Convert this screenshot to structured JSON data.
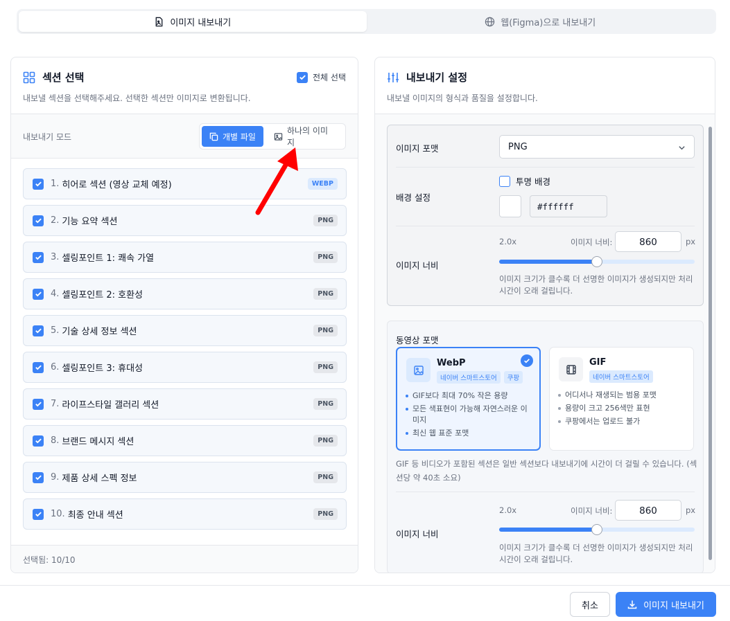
{
  "tabs": [
    {
      "label": "이미지 내보내기",
      "icon": "image-file-icon",
      "active": true
    },
    {
      "label": "웹(Figma)으로 내보내기",
      "icon": "globe-icon",
      "active": false
    }
  ],
  "left": {
    "title": "섹션 선택",
    "description": "내보낼 섹션을 선택해주세요. 선택한 섹션만 이미지로 변환됩니다.",
    "select_all_label": "전체 선택",
    "mode_label": "내보내기 모드",
    "mode_options": [
      "개별 파일",
      "하나의 이미지"
    ],
    "sections": [
      {
        "num": "1.",
        "name": "히어로 섹션 (영상 교체 예정)",
        "format": "WEBP"
      },
      {
        "num": "2.",
        "name": "기능 요약 섹션",
        "format": "PNG"
      },
      {
        "num": "3.",
        "name": "셀링포인트 1: 쾌속 가열",
        "format": "PNG"
      },
      {
        "num": "4.",
        "name": "셀링포인트 2: 호환성",
        "format": "PNG"
      },
      {
        "num": "5.",
        "name": "기술 상세 정보 섹션",
        "format": "PNG"
      },
      {
        "num": "6.",
        "name": "셀링포인트 3: 휴대성",
        "format": "PNG"
      },
      {
        "num": "7.",
        "name": "라이프스타일 갤러리 섹션",
        "format": "PNG"
      },
      {
        "num": "8.",
        "name": "브랜드 메시지 섹션",
        "format": "PNG"
      },
      {
        "num": "9.",
        "name": "제품 상세 스펙 정보",
        "format": "PNG"
      },
      {
        "num": "10.",
        "name": "최종 안내 섹션",
        "format": "PNG"
      }
    ],
    "footer": "선택됨: 10/10"
  },
  "right": {
    "title": "내보내기 설정",
    "description": "내보낼 이미지의 형식과 품질을 설정합니다.",
    "image_format_label": "이미지 포맷",
    "image_format_value": "PNG",
    "background_label": "배경 설정",
    "transparent_label": "투명 배경",
    "transparent_checked": false,
    "bg_color": "#ffffff",
    "image_width_label": "이미지 너비",
    "scale": "2.0x",
    "width_field_label": "이미지 너비:",
    "width_value": "860",
    "unit": "px",
    "slider_fraction": 0.5,
    "help_text": "이미지 크기가 클수록 더 선명한 이미지가 생성되지만 처리 시간이 오래 걸립니다.",
    "video_format_label": "동영상 포맷",
    "video_options": [
      {
        "name": "WebP",
        "icon": "image-icon",
        "selected": true,
        "tags": [
          "네이버 스마트스토어",
          "쿠팡"
        ],
        "bullets": [
          "GIF보다 최대 70% 작은 용량",
          "모든 색표현이 가능해 자연스러운 이미지",
          "최신 웹 표준 포맷"
        ]
      },
      {
        "name": "GIF",
        "icon": "film-icon",
        "selected": false,
        "tags": [
          "네이버 스마트스토어"
        ],
        "bullets": [
          "어디서나 재생되는 범용 포맷",
          "용량이 크고 256색만 표현",
          "쿠팡에서는 업로드 불가"
        ]
      }
    ],
    "video_note": "GIF 등 비디오가 포함된 섹션은 일반 섹션보다 내보내기에 시간이 더 걸릴 수 있습니다. (섹션당 약 40초 소요)",
    "video_width_label": "이미지 너비",
    "video_scale": "2.0x",
    "video_width_value": "860",
    "video_slider_fraction": 0.5
  },
  "footer": {
    "cancel_label": "취소",
    "export_label": "이미지 내보내기"
  },
  "colors": {
    "accent": "#3b82f6",
    "annotation_arrow": "#ff0000"
  }
}
